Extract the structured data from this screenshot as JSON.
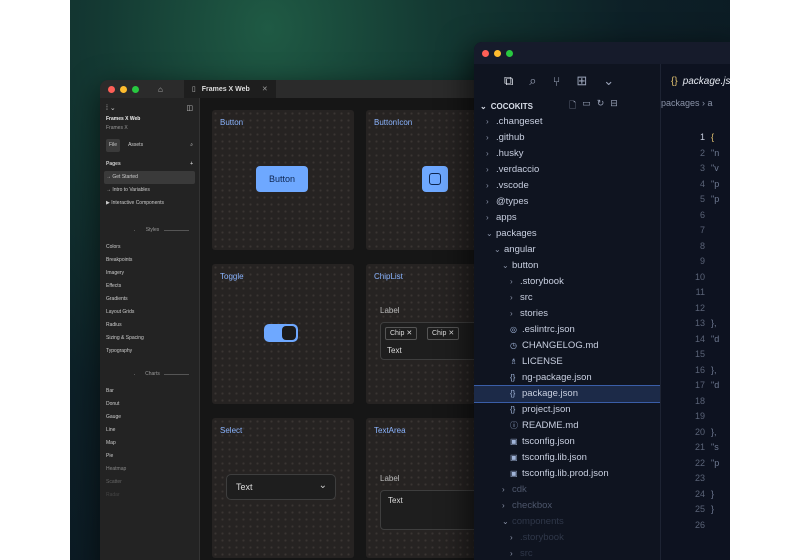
{
  "figma": {
    "tab_title": "Frames X Web",
    "file_name": "Frames X Web",
    "file_sub": "Frames X",
    "nav_file": "File",
    "nav_assets": "Assets",
    "pages_label": "Pages",
    "pages": [
      "→ Get Started",
      "→ Intro to Variables",
      "▶ Interactive Components"
    ],
    "styles_label": "Styles",
    "styles": [
      "Colors",
      "Breakpoints",
      "Imagery",
      "Effects",
      "Gradients",
      "Layout Grids",
      "Radius",
      "Sizing & Spacing",
      "Typography"
    ],
    "charts_label": "Charts",
    "charts": [
      "Bar",
      "Donut",
      "Gauge",
      "Line",
      "Map",
      "Pie",
      "Heatmap",
      "Scatter",
      "Radar"
    ],
    "cards": {
      "button": {
        "title": "Button",
        "label": "Button"
      },
      "buttonicon": {
        "title": "ButtonIcon"
      },
      "toggle": {
        "title": "Toggle"
      },
      "chiplist": {
        "title": "ChipList",
        "label": "Label",
        "chip1": "Chip ✕",
        "chip2": "Chip ✕",
        "text": "Text"
      },
      "select": {
        "title": "Select",
        "value": "Text"
      },
      "textarea": {
        "title": "TextArea",
        "label": "Label",
        "text": "Text"
      }
    },
    "accent": "#6ea8ff"
  },
  "vscode": {
    "explorer_title": "COCOKITS",
    "tab_title": "package.js",
    "breadcrumb": "packages › a",
    "tree": [
      {
        "label": ".changeset",
        "arrow": "›",
        "depth": 0
      },
      {
        "label": ".github",
        "arrow": "›",
        "depth": 0
      },
      {
        "label": ".husky",
        "arrow": "›",
        "depth": 0
      },
      {
        "label": ".verdaccio",
        "arrow": "›",
        "depth": 0
      },
      {
        "label": ".vscode",
        "arrow": "›",
        "depth": 0
      },
      {
        "label": "@types",
        "arrow": "›",
        "depth": 0
      },
      {
        "label": "apps",
        "arrow": "›",
        "depth": 0
      },
      {
        "label": "packages",
        "arrow": "⌄",
        "depth": 0
      },
      {
        "label": "angular",
        "arrow": "⌄",
        "depth": 1
      },
      {
        "label": "button",
        "arrow": "⌄",
        "depth": 2
      },
      {
        "label": ".storybook",
        "arrow": "›",
        "depth": 3
      },
      {
        "label": "src",
        "arrow": "›",
        "depth": 3
      },
      {
        "label": "stories",
        "arrow": "›",
        "depth": 3
      },
      {
        "label": ".eslintrc.json",
        "icon": "◎",
        "depth": 3
      },
      {
        "label": "CHANGELOG.md",
        "icon": "◷",
        "depth": 3
      },
      {
        "label": "LICENSE",
        "icon": "♗",
        "depth": 3
      },
      {
        "label": "ng-package.json",
        "icon": "{}",
        "depth": 3
      },
      {
        "label": "package.json",
        "icon": "{}",
        "depth": 3,
        "selected": true
      },
      {
        "label": "project.json",
        "icon": "{}",
        "depth": 3
      },
      {
        "label": "README.md",
        "icon": "ⓘ",
        "depth": 3
      },
      {
        "label": "tsconfig.json",
        "icon": "▣",
        "depth": 3
      },
      {
        "label": "tsconfig.lib.json",
        "icon": "▣",
        "depth": 3
      },
      {
        "label": "tsconfig.lib.prod.json",
        "icon": "▣",
        "depth": 3
      },
      {
        "label": "cdk",
        "arrow": "›",
        "depth": 2,
        "dim": 1
      },
      {
        "label": "checkbox",
        "arrow": "›",
        "depth": 2,
        "dim": 1
      },
      {
        "label": "components",
        "arrow": "⌄",
        "depth": 2,
        "dim": 2
      },
      {
        "label": ".storybook",
        "arrow": "›",
        "depth": 3,
        "dim": 2
      },
      {
        "label": "src",
        "arrow": "›",
        "depth": 3,
        "dim": 2
      }
    ],
    "line_numbers": [
      "1",
      "2",
      "3",
      "4",
      "5",
      "6",
      "7",
      "8",
      "9",
      "10",
      "11",
      "12",
      "13",
      "14",
      "15",
      "16",
      "17",
      "18",
      "19",
      "20",
      "21",
      "22",
      "23",
      "24",
      "25",
      "26"
    ],
    "code_lines": [
      "{",
      "\"n",
      "\"v",
      "\"p",
      "\"p",
      "",
      "",
      "",
      "",
      "",
      "",
      "",
      "},",
      "\"d",
      "",
      "},",
      "\"d",
      "",
      "",
      "},",
      "\"s",
      "\"p",
      "",
      "}",
      "}",
      ""
    ]
  }
}
